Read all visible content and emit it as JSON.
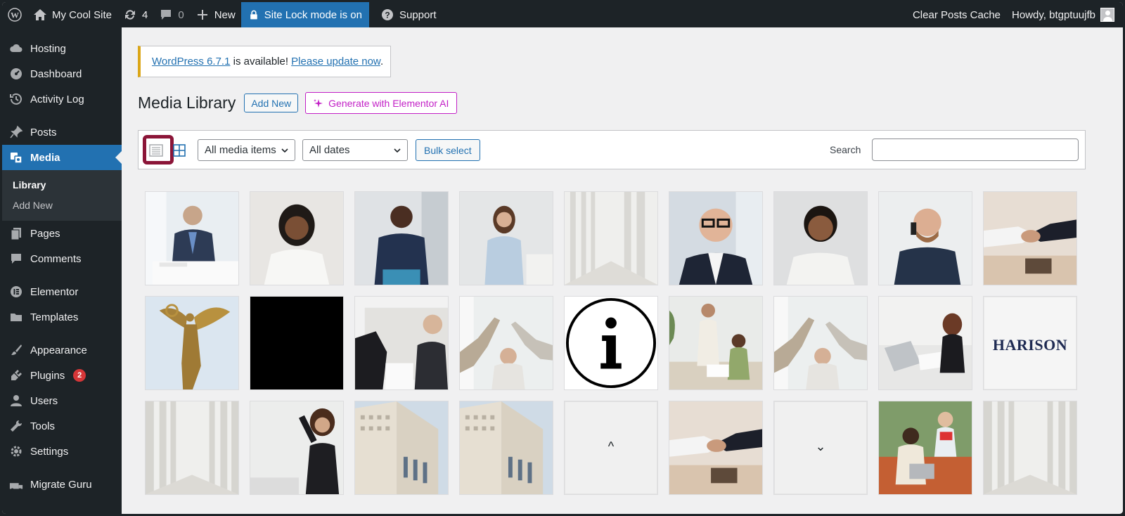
{
  "adminbar": {
    "site_name": "My Cool Site",
    "updates_count": "4",
    "comments_count": "0",
    "new_label": "New",
    "site_lock_label": "Site Lock mode is on",
    "support_label": "Support",
    "clear_cache_label": "Clear Posts Cache",
    "howdy_label": "Howdy, btgptuujfb"
  },
  "sidebar": {
    "items": [
      {
        "label": "Hosting",
        "icon": "cloud-icon"
      },
      {
        "label": "Dashboard",
        "icon": "dashboard-icon"
      },
      {
        "label": "Activity Log",
        "icon": "history-icon"
      },
      {
        "label": "Posts",
        "icon": "pin-icon"
      },
      {
        "label": "Media",
        "icon": "media-icon"
      },
      {
        "label": "Pages",
        "icon": "pages-icon"
      },
      {
        "label": "Comments",
        "icon": "comment-icon"
      },
      {
        "label": "Elementor",
        "icon": "elementor-icon"
      },
      {
        "label": "Templates",
        "icon": "folder-icon"
      },
      {
        "label": "Appearance",
        "icon": "brush-icon"
      },
      {
        "label": "Plugins",
        "icon": "plugin-icon",
        "badge": "2"
      },
      {
        "label": "Users",
        "icon": "user-icon"
      },
      {
        "label": "Tools",
        "icon": "wrench-icon"
      },
      {
        "label": "Settings",
        "icon": "settings-icon"
      },
      {
        "label": "Migrate Guru",
        "icon": "migrate-icon"
      }
    ],
    "media_submenu": {
      "library": "Library",
      "add_new": "Add New"
    }
  },
  "notice": {
    "link1": "WordPress 6.7.1",
    "text": " is available! ",
    "link2": "Please update now",
    "tail": "."
  },
  "page": {
    "title": "Media Library",
    "add_new": "Add New",
    "generate_ai": "Generate with Elementor AI"
  },
  "toolbar": {
    "filter_media": "All media items",
    "filter_dates": "All dates",
    "bulk_select": "Bulk select",
    "search_label": "Search",
    "search_value": ""
  },
  "media": {
    "logo_text": "HARISON",
    "up_arrow": "^",
    "down_arrow": "⌄"
  },
  "colors": {
    "accent": "#2271b1",
    "sidebar_bg": "#1d2327",
    "ai_magenta": "#c21fc6",
    "highlight": "#8b1538",
    "notice_warning": "#dba617",
    "badge_red": "#d63638"
  }
}
